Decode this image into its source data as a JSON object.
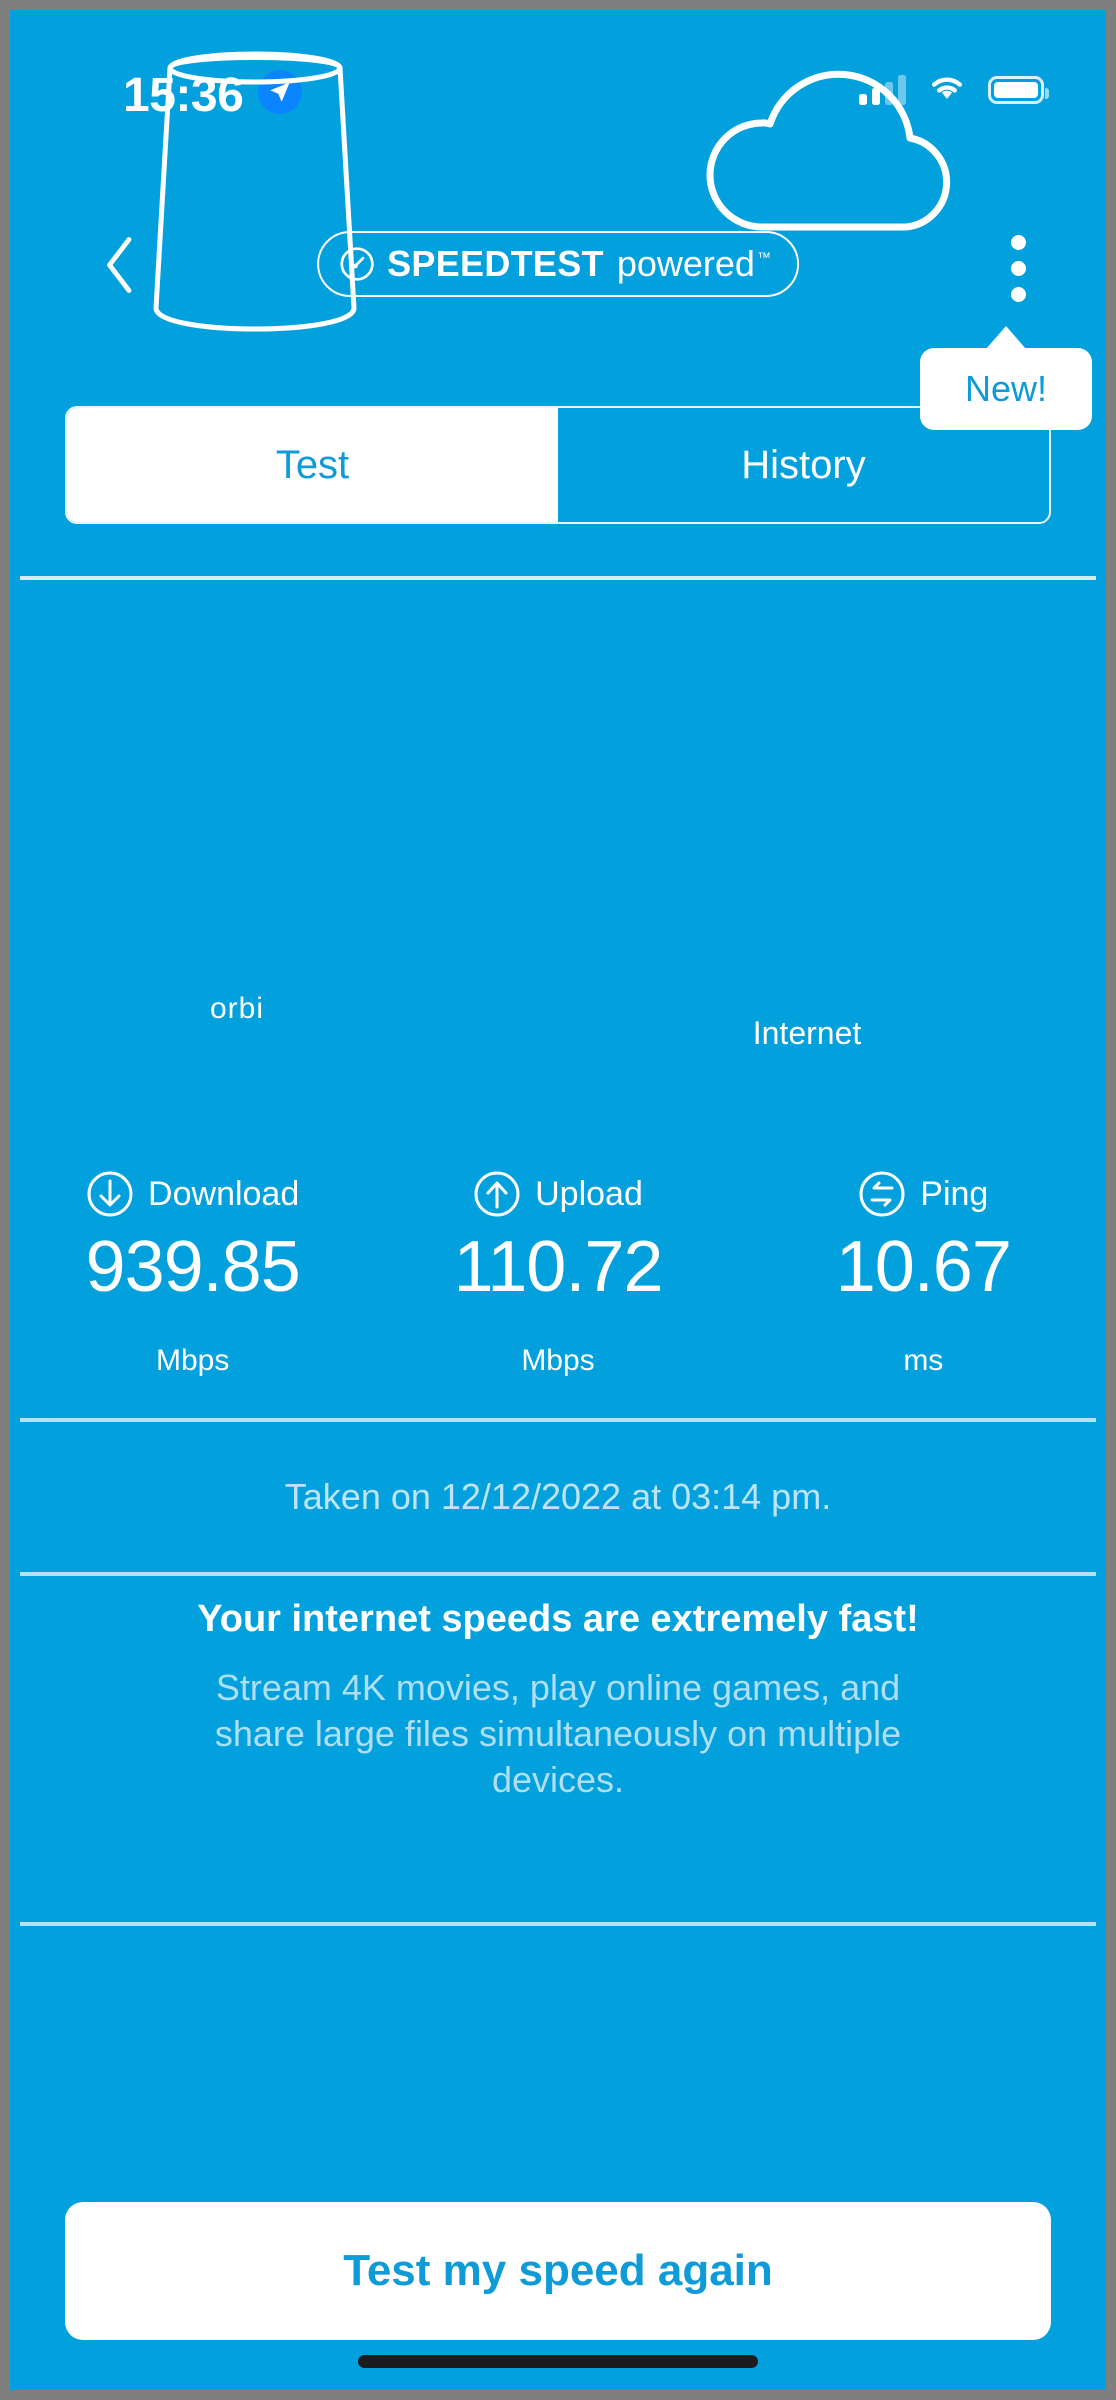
{
  "theme": {
    "brand_blue": "#03A0DE",
    "accent_text_blue": "#0E9BD8",
    "muted_text": "#AEDFF5",
    "white": "#FFFFFF",
    "frame_border": "#7F7F7F"
  },
  "status_bar": {
    "time": "15:36",
    "location_icon": "location-arrow-icon",
    "cellular_icon": "cellular-signal-icon",
    "cellular_bars_filled": 2,
    "cellular_bars_total": 4,
    "wifi_icon": "wifi-icon",
    "battery_icon": "battery-icon",
    "battery_level_percent": 100
  },
  "navbar": {
    "back_icon": "chevron-left-icon",
    "logo": {
      "icon": "speedometer-icon",
      "bold_text": "SPEEDTEST",
      "light_text": "powered",
      "trademark": "™"
    },
    "menu_icon": "kebab-menu-icon",
    "tooltip": {
      "label": "New!"
    }
  },
  "tabs": [
    {
      "label": "Test",
      "active": true
    },
    {
      "label": "History",
      "active": false
    }
  ],
  "illustration": {
    "router": {
      "icon": "orbi-router-icon",
      "brand_label": "orbi"
    },
    "cloud": {
      "icon": "cloud-icon",
      "label": "Internet"
    }
  },
  "metrics": [
    {
      "icon": "download-arrow-icon",
      "label": "Download",
      "value": "939.85",
      "unit": "Mbps"
    },
    {
      "icon": "upload-arrow-icon",
      "label": "Upload",
      "value": "110.72",
      "unit": "Mbps"
    },
    {
      "icon": "ping-exchange-icon",
      "label": "Ping",
      "value": "10.67",
      "unit": "ms"
    }
  ],
  "timestamp": {
    "text": "Taken on 12/12/2022 at 03:14 pm."
  },
  "result_message": {
    "title": "Your internet speeds are extremely fast!",
    "subtitle": "Stream 4K movies, play online games, and share large files simultaneously on multiple devices."
  },
  "cta": {
    "label": "Test my speed again"
  },
  "home_indicator": {
    "name": "home-indicator-bar"
  }
}
